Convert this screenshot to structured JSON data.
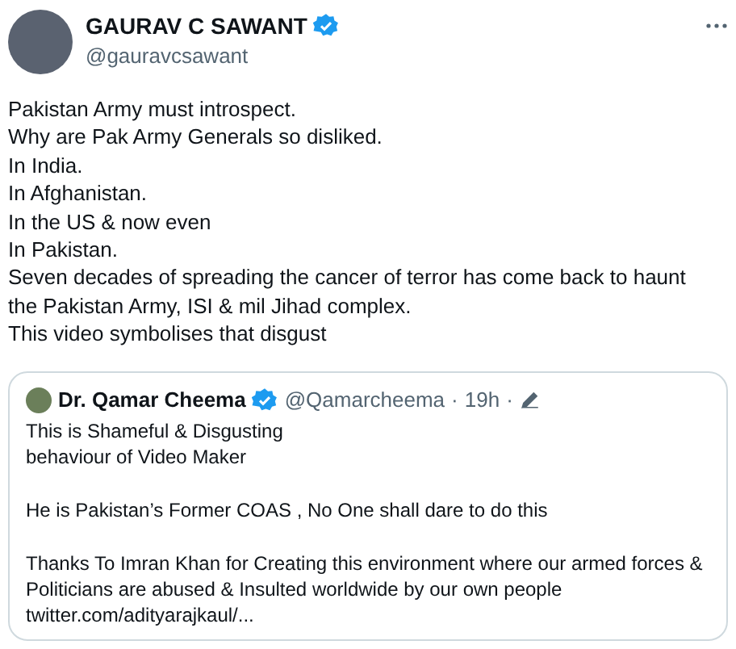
{
  "author": {
    "name": "GAURAV C SAWANT",
    "verified": true,
    "handle": "@gauravcsawant"
  },
  "text_lines": [
    "Pakistan Army must introspect.",
    "Why are Pak Army Generals so disliked.",
    "In India.",
    "In Afghanistan.",
    "In the US & now even",
    "In Pakistan.",
    "Seven decades of spreading the cancer of terror has come back to haunt",
    "the Pakistan Army, ISI & mil Jihad complex.",
    "This video symbolises that disgust"
  ],
  "quote": {
    "name": "Dr. Qamar Cheema",
    "verified": true,
    "handle": "@Qamarcheema",
    "separator": "·",
    "time": "19h",
    "separator_2": "·",
    "paragraphs": [
      [
        "This is Shameful & Disgusting",
        "behaviour of Video Maker"
      ],
      [
        "He is Pakistan’s Former COAS , No One shall dare to do this"
      ],
      [
        "Thanks To Imran Khan for Creating this environment where our armed forces &",
        "Politicians are abused & Insulted worldwide by our own people"
      ]
    ],
    "link": "twitter.com/adityarajkaul/..."
  }
}
